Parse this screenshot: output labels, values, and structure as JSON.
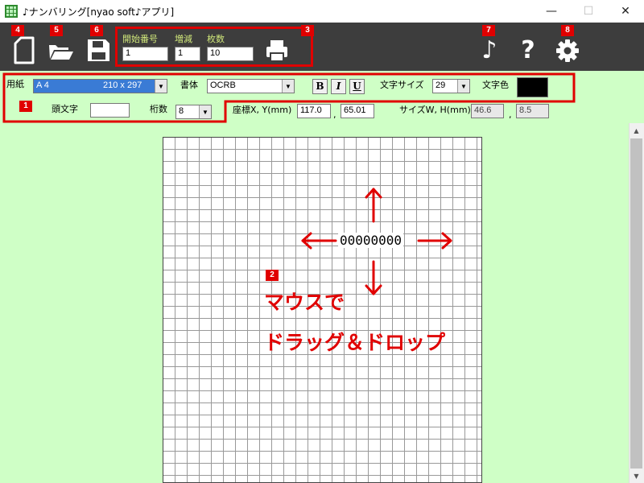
{
  "window": {
    "title": "♪ナンバリング[nyao soft♪アプリ]",
    "minimize": "—",
    "maximize": "☐",
    "close": "✕"
  },
  "toolbar": {
    "start_number_label": "開始番号",
    "start_number_value": "1",
    "increment_label": "増減",
    "increment_value": "1",
    "count_label": "枚数",
    "count_value": "10",
    "icons": [
      "new-document-icon",
      "open-folder-icon",
      "save-icon",
      "printer-icon",
      "music-note-icon",
      "help-icon",
      "gear-icon"
    ],
    "music_glyph": "♪",
    "help_glyph": "?"
  },
  "badges": {
    "b1": "1",
    "b2": "2",
    "b3": "3",
    "b4": "4",
    "b5": "5",
    "b6": "6",
    "b7": "7",
    "b8": "8"
  },
  "options": {
    "paper_label": "用紙",
    "paper_value": "A 4",
    "paper_size": "210 x 297",
    "font_label": "書体",
    "font_value": "OCRB",
    "bold_label": "B",
    "italic_label": "I",
    "underline_label": "U",
    "font_size_label": "文字サイズ",
    "font_size_value": "29",
    "color_label": "文字色",
    "text_color": "#000000",
    "prefix_label": "頭文字",
    "prefix_value": "",
    "digits_label": "桁数",
    "digits_value": "8",
    "pos_label": "座標X, Y(mm)",
    "pos_x": "117.0",
    "pos_y": "65.01",
    "size_label": "サイズW, H(mm)",
    "size_w": "46.6",
    "size_h": "8.5",
    "separator": ","
  },
  "canvas": {
    "number_text": "00000000",
    "instruction_line1": "マウスで",
    "instruction_line2": "ドラッグ＆ドロップ"
  },
  "colors": {
    "toolbar_bg": "#3d3d3d",
    "panel_bg": "#cfffc6",
    "accent_red": "#e00000",
    "label_green": "#cfe67a"
  }
}
